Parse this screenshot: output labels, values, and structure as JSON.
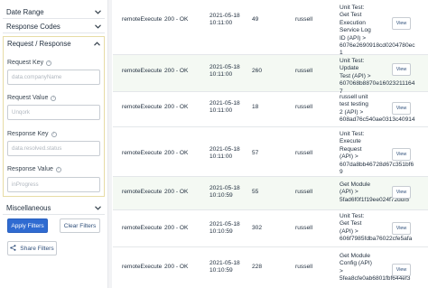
{
  "sidebar": {
    "date_range": "Date Range",
    "response_codes": "Response Codes",
    "request_response": "Request / Response",
    "request_key": {
      "label": "Request Key",
      "placeholder": "data.companyName"
    },
    "request_value": {
      "label": "Request Value",
      "placeholder": "Unqork"
    },
    "response_key": {
      "label": "Response Key",
      "placeholder": "data.resolved.status"
    },
    "response_value": {
      "label": "Response Value",
      "placeholder": "inProgress"
    },
    "miscellaneous": "Miscellaneous",
    "apply_filters": "Apply Filters",
    "clear_filters": "Clear Filters",
    "share_filters": "Share Filters"
  },
  "table": {
    "view_label": "View",
    "rows": [
      {
        "execution": "remoteExecute",
        "status": "200 - OK",
        "date": "2021-05-18",
        "time": "10:11:00",
        "ms": "49",
        "user": "russell",
        "test_lines": [
          "Unit Test:",
          "Get Test",
          "Execution",
          "Service Log",
          "ID (API) >",
          "6076e2690918cd0204780ec1"
        ]
      },
      {
        "execution": "remoteExecute",
        "status": "200 - OK",
        "date": "2021-05-18",
        "time": "10:11:00",
        "ms": "260",
        "user": "russell",
        "test_lines": [
          "Unit Test:",
          "Update",
          "Test (API) >",
          "607068b8870e160232111647"
        ]
      },
      {
        "execution": "remoteExecute",
        "status": "200 - OK",
        "date": "2021-05-18",
        "time": "10:11:00",
        "ms": "18",
        "user": "russell",
        "test_lines": [
          "russell unit",
          "test testing",
          "2 (API) >",
          "608ad76c540ae0313c40914"
        ]
      },
      {
        "execution": "remoteExecute",
        "status": "200 - OK",
        "date": "2021-05-18",
        "time": "10:11:00",
        "ms": "57",
        "user": "russell",
        "test_lines": [
          "Unit Test:",
          "Execute",
          "Request",
          "(API) >",
          "607da8bb46728d67c351bf69"
        ]
      },
      {
        "execution": "remoteExecute",
        "status": "200 - OK",
        "date": "2021-05-18",
        "time": "10:10:59",
        "ms": "55",
        "user": "russell",
        "test_lines": [
          "Get Module",
          "(API) >",
          "5fad6f0f1f19ee024f72ddf5"
        ]
      },
      {
        "execution": "remoteExecute",
        "status": "200 - OK",
        "date": "2021-05-18",
        "time": "10:10:59",
        "ms": "302",
        "user": "russell",
        "test_lines": [
          "Unit Test:",
          "Get Test",
          "(API) >",
          "606f7985fdba76022cfe5afa"
        ]
      },
      {
        "execution": "remoteExecute",
        "status": "200 - OK",
        "date": "2021-05-18",
        "time": "10:10:59",
        "ms": "228",
        "user": "russell",
        "test_lines": [
          "Get Module",
          "Config (API)",
          ">",
          "5fea8cfe0ab6801fbf644ef3"
        ]
      }
    ]
  },
  "colors": {
    "primary": "#2f6bd1",
    "row_alt": "#f4f9f3",
    "panel_border": "#e7dca6"
  },
  "icons": [
    "chevron-down-icon",
    "chevron-up-icon",
    "info-icon",
    "share-icon"
  ]
}
